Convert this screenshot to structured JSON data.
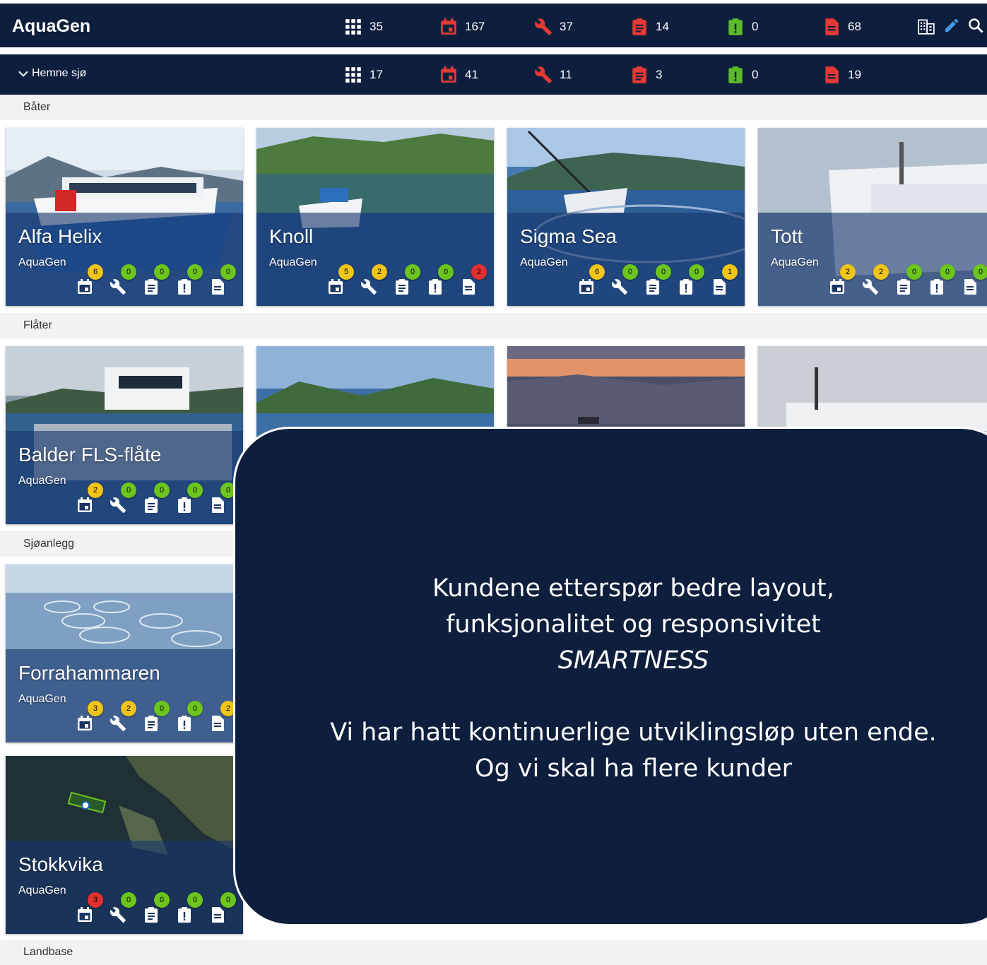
{
  "app": {
    "brand": "AquaGen"
  },
  "top_stats": [
    {
      "icon": "grid-icon",
      "value": "35"
    },
    {
      "icon": "calendar-icon",
      "value": "167"
    },
    {
      "icon": "wrench-icon",
      "value": "37"
    },
    {
      "icon": "clipboard-icon",
      "value": "14"
    },
    {
      "icon": "alert-clipboard-icon",
      "value": "0"
    },
    {
      "icon": "document-icon",
      "value": "68"
    }
  ],
  "group": {
    "name": "Hemne sjø",
    "stats": [
      {
        "icon": "grid-icon",
        "value": "17"
      },
      {
        "icon": "calendar-icon",
        "value": "41"
      },
      {
        "icon": "wrench-icon",
        "value": "11"
      },
      {
        "icon": "clipboard-icon",
        "value": "3"
      },
      {
        "icon": "alert-clipboard-icon",
        "value": "0"
      },
      {
        "icon": "document-icon",
        "value": "19"
      }
    ]
  },
  "sections": {
    "boats": "Båter",
    "rafts": "Flåter",
    "sea_sites": "Sjøanlegg",
    "land_base": "Landbase"
  },
  "cards": {
    "alfa": {
      "title": "Alfa Helix",
      "owner": "AquaGen",
      "badges": [
        "6",
        "0",
        "0",
        "0",
        "0"
      ]
    },
    "knoll": {
      "title": "Knoll",
      "owner": "AquaGen",
      "badges": [
        "5",
        "2",
        "0",
        "0",
        "2"
      ]
    },
    "sigma": {
      "title": "Sigma Sea",
      "owner": "AquaGen",
      "badges": [
        "6",
        "0",
        "0",
        "0",
        "1"
      ]
    },
    "tott": {
      "title": "Tott",
      "owner": "AquaGen",
      "badges": [
        "2",
        "2",
        "0",
        "0",
        "0"
      ]
    },
    "balder": {
      "title": "Balder FLS-flåte",
      "owner": "AquaGen",
      "badges": [
        "2",
        "0",
        "0",
        "0",
        "0"
      ]
    },
    "forra": {
      "title": "Forrahammaren",
      "owner": "AquaGen",
      "badges": [
        "3",
        "2",
        "0",
        "0",
        "2"
      ]
    },
    "stokk": {
      "title": "Stokkvika",
      "owner": "AquaGen",
      "badges": [
        "3",
        "0",
        "0",
        "0",
        "0"
      ]
    }
  },
  "colors": {
    "navy": "#0e1f3d",
    "badge_yellow": "#f0c419",
    "badge_green": "#6cc51d",
    "badge_red": "#e03030",
    "icon_red": "#e53935",
    "icon_green": "#5cb82e"
  },
  "message": {
    "line1": "Kundene etterspør bedre layout,",
    "line2": "funksjonalitet og responsivitet",
    "line3": "SMARTNESS",
    "line4": "Vi har hatt kontinuerlige utviklingsløp uten ende.",
    "line5": "Og vi skal ha flere kunder"
  }
}
